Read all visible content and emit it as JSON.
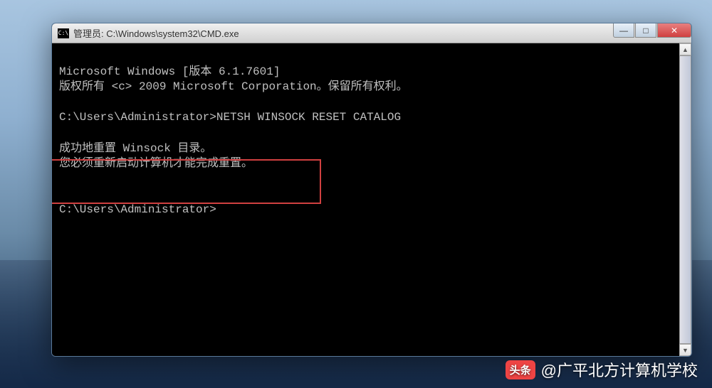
{
  "window": {
    "title": "管理员: C:\\Windows\\system32\\CMD.exe"
  },
  "terminal": {
    "line1": "Microsoft Windows [版本 6.1.7601]",
    "line2": "版权所有 <c> 2009 Microsoft Corporation。保留所有权利。",
    "blank1": "",
    "prompt1": "C:\\Users\\Administrator>NETSH WINSOCK RESET CATALOG",
    "blank2": "",
    "result1": "成功地重置 Winsock 目录。",
    "result2": "您必须重新启动计算机才能完成重置。",
    "blank3": "",
    "blank4": "",
    "prompt2": "C:\\Users\\Administrator>"
  },
  "controls": {
    "minimize": "—",
    "maximize": "□",
    "close": "✕"
  },
  "watermark": {
    "badge": "头条",
    "text": "@广平北方计算机学校"
  },
  "scrollbar": {
    "up": "▲",
    "down": "▼"
  }
}
